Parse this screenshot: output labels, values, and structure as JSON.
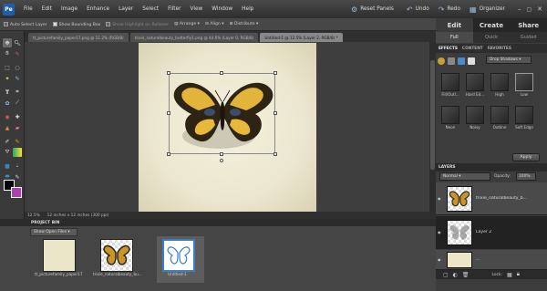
{
  "menubar": {
    "items": [
      "File",
      "Edit",
      "Image",
      "Enhance",
      "Layer",
      "Select",
      "Filter",
      "View",
      "Window",
      "Help"
    ],
    "reset_panels": "Reset Panels",
    "undo": "Undo",
    "redo": "Redo",
    "organizer": "Organizer"
  },
  "modes": {
    "edit": "Edit",
    "create": "Create",
    "share": "Share"
  },
  "optbar": {
    "auto_select": "Auto Select Layer",
    "show_bounding": "Show Bounding Box",
    "show_highlight": "Show Highlight on Rollover",
    "arrange": "Arrange",
    "align": "Align",
    "distribute": "Distribute"
  },
  "doc_tabs": [
    "tt_picturefamily_paper17.png @ 11.2% (RGB/8)",
    "trixie_naturalbeauty_butterfly1.png @ 44.6% (Layer 0, RGB/8)",
    "Untitled-1 @ 12.5% (Layer 2, RGB/8) *"
  ],
  "edit_subtabs": [
    "Full",
    "Quick",
    "Guided"
  ],
  "status": {
    "zoom": "12.5%",
    "size": "12 inches x 12 inches (300 ppi)"
  },
  "project_bin": {
    "title": "PROJECT BIN",
    "selector": "Show Open Files",
    "items": [
      {
        "label": "tt_picturefamily_paper17"
      },
      {
        "label": "trixie_naturalbeauty_bu..."
      },
      {
        "label": "Untitled-1"
      }
    ]
  },
  "effects": {
    "tabs": [
      "EFFECTS",
      "CONTENT",
      "FAVORITES"
    ],
    "category": "Drop Shadows",
    "swatches": [
      "Fill/Outl...",
      "Hard Ed...",
      "High",
      "Low",
      "Neon",
      "Noisy",
      "Outline",
      "Soft Edge"
    ],
    "apply": "Apply"
  },
  "layers": {
    "title": "LAYERS",
    "blend_mode": "Normal",
    "opacity_label": "Opacity:",
    "opacity_value": "100%",
    "items": [
      {
        "name": "trixie_naturalbeauty_b..."
      },
      {
        "name": "Layer 2"
      },
      {
        "name": "..."
      }
    ],
    "lock_label": "Lock:"
  }
}
